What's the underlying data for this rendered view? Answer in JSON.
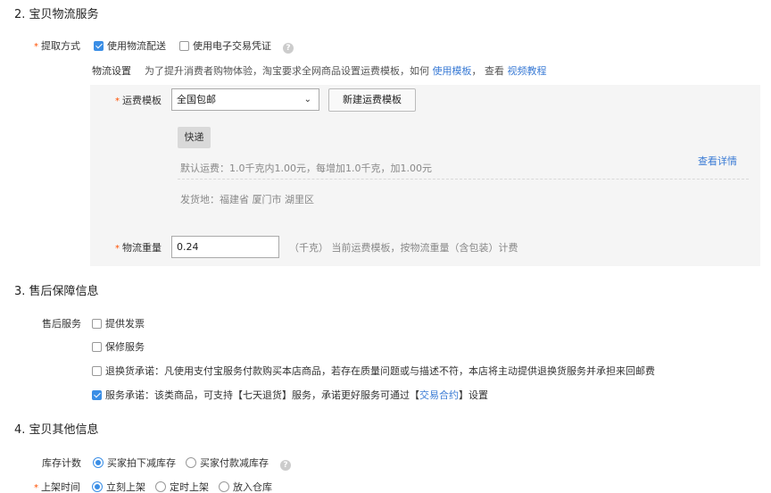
{
  "section2": {
    "title": "2. 宝贝物流服务",
    "pickup": {
      "label": "提取方式",
      "opt1": "使用物流配送",
      "opt2": "使用电子交易凭证"
    },
    "logistics": {
      "label": "物流设置",
      "text": "为了提升消费者购物体验，淘宝要求全网商品设置运费模板，如何",
      "link1": "使用模板",
      "sep": "，  查看",
      "link2": "视频教程"
    },
    "template": {
      "label": "运费模板",
      "selected": "全国包邮",
      "new_button": "新建运费模板",
      "tag": "快递",
      "default_fee": "默认运费：1.0千克内1.00元，每增加1.0千克，加1.00元",
      "detail_link": "查看详情",
      "ship_from": "发货地：福建省 厦门市 湖里区"
    },
    "weight": {
      "label": "物流重量",
      "value": "0.24",
      "hint": "（千克）  当前运费模板，按物流重量（含包装）计费"
    }
  },
  "section3": {
    "title": "3. 售后保障信息",
    "label": "售后服务",
    "opt_invoice": "提供发票",
    "opt_warranty": "保修服务",
    "opt_return": "退换货承诺：凡使用支付宝服务付款购买本店商品，若存在质量问题或与描述不符，本店将主动提供退换货服务并承担来回邮费",
    "opt_service_pre": "服务承诺：该类商品，可支持【七天退货】服务，承诺更好服务可通过【",
    "opt_service_link": "交易合约",
    "opt_service_post": "】设置"
  },
  "section4": {
    "title": "4. 宝贝其他信息",
    "stock": {
      "label": "库存计数",
      "opt1": "买家拍下减库存",
      "opt2": "买家付款减库存"
    },
    "listing": {
      "label": "上架时间",
      "opt1": "立刻上架",
      "opt2": "定时上架",
      "opt3": "放入仓库"
    }
  },
  "colors": {
    "accent": "#3a8ee6",
    "required": "#ff5000",
    "link": "#3a7bd5",
    "panel_bg": "#f5f5f5"
  }
}
